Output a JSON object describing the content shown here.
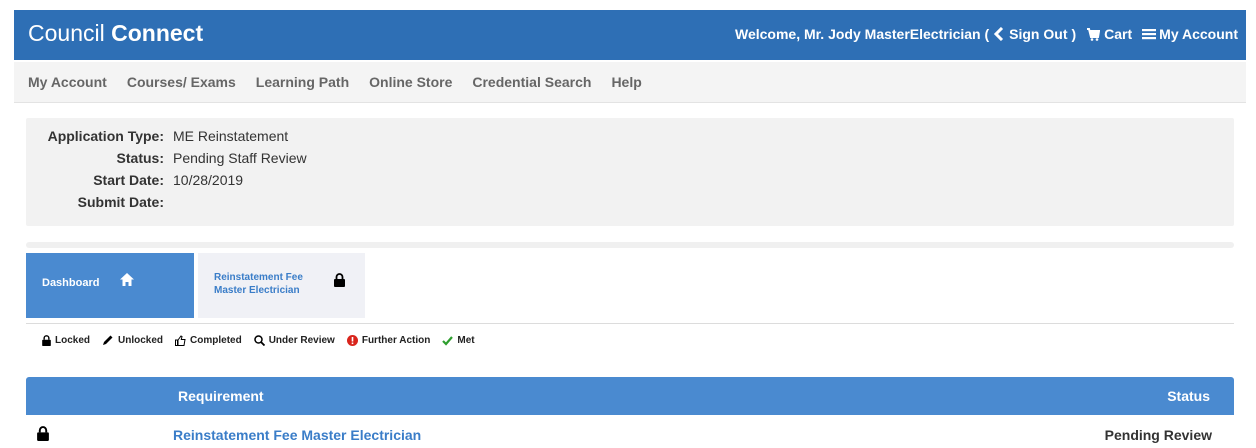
{
  "header": {
    "logo_part1": "Council ",
    "logo_part2": "Connect",
    "welcome": "Welcome, Mr. Jody MasterElectrician (",
    "sign_out": "Sign Out",
    "close_paren": ")",
    "cart": "Cart",
    "my_account": "My Account",
    "icons": {
      "back": "chevron-left-icon",
      "cart": "cart-icon",
      "menu": "hamburger-icon"
    }
  },
  "nav": {
    "items": [
      {
        "label": "My Account"
      },
      {
        "label": "Courses/ Exams"
      },
      {
        "label": "Learning Path"
      },
      {
        "label": "Online Store"
      },
      {
        "label": "Credential Search"
      },
      {
        "label": "Help"
      }
    ]
  },
  "application": {
    "type_label": "Application Type:",
    "type_value": "ME Reinstatement",
    "status_label": "Status:",
    "status_value": "Pending Staff Review",
    "start_label": "Start Date:",
    "start_value": "10/28/2019",
    "submit_label": "Submit Date:",
    "submit_value": ""
  },
  "tabs": {
    "dashboard": "Dashboard",
    "fee_line1": "Reinstatement Fee",
    "fee_line2": "Master Electrician"
  },
  "legend": {
    "locked": "Locked",
    "unlocked": "Unlocked",
    "completed": "Completed",
    "under_review": "Under Review",
    "further_action": "Further Action",
    "met": "Met"
  },
  "requirements": {
    "col_requirement": "Requirement",
    "col_status": "Status",
    "rows": [
      {
        "name": "Reinstatement Fee Master Electrician",
        "status": "Pending Review",
        "icon": "lock-icon"
      }
    ]
  },
  "colors": {
    "brand_blue": "#2e6fb5",
    "tab_blue": "#4a8ad0",
    "link_blue": "#3a7dc8",
    "error_red": "#d9241c",
    "met_green": "#2e9e2e"
  }
}
